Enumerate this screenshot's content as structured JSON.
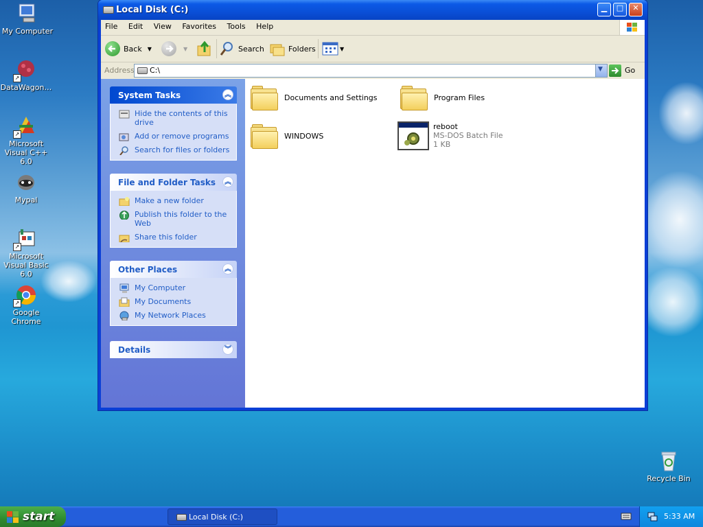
{
  "desktop": {
    "icons": [
      {
        "label": "My Computer",
        "icon": "my-computer-icon"
      },
      {
        "label": "DataWagon…",
        "icon": "datawagon-icon"
      },
      {
        "label": "Microsoft Visual C++ 6.0",
        "icon": "visual-cpp-icon"
      },
      {
        "label": "Mypal",
        "icon": "mypal-icon"
      },
      {
        "label": "Microsoft Visual Basic 6.0",
        "icon": "visual-basic-icon"
      },
      {
        "label": "Google Chrome",
        "icon": "chrome-icon"
      }
    ],
    "recycle_bin": {
      "label": "Recycle Bin",
      "icon": "recycle-bin-icon"
    }
  },
  "window": {
    "title": "Local Disk (C:)",
    "menu": [
      "File",
      "Edit",
      "View",
      "Favorites",
      "Tools",
      "Help"
    ],
    "toolbar": {
      "back": "Back",
      "search": "Search",
      "folders": "Folders"
    },
    "address": {
      "label": "Address",
      "value": "C:\\",
      "go": "Go"
    }
  },
  "sidebar": {
    "system_tasks": {
      "title": "System Tasks",
      "items": [
        "Hide the contents of this drive",
        "Add or remove programs",
        "Search for files or folders"
      ]
    },
    "file_folder_tasks": {
      "title": "File and Folder Tasks",
      "items": [
        "Make a new folder",
        "Publish this folder to the Web",
        "Share this folder"
      ]
    },
    "other_places": {
      "title": "Other Places",
      "items": [
        "My Computer",
        "My Documents",
        "My Network Places"
      ]
    },
    "details": {
      "title": "Details"
    }
  },
  "content": {
    "items": [
      {
        "name": "Documents and Settings",
        "type": "folder"
      },
      {
        "name": "Program Files",
        "type": "folder"
      },
      {
        "name": "WINDOWS",
        "type": "folder"
      },
      {
        "name": "reboot",
        "type": "MS-DOS Batch File",
        "size": "1 KB"
      }
    ]
  },
  "taskbar": {
    "start": "start",
    "task_button": "Local Disk (C:)",
    "clock": "5:33 AM"
  }
}
